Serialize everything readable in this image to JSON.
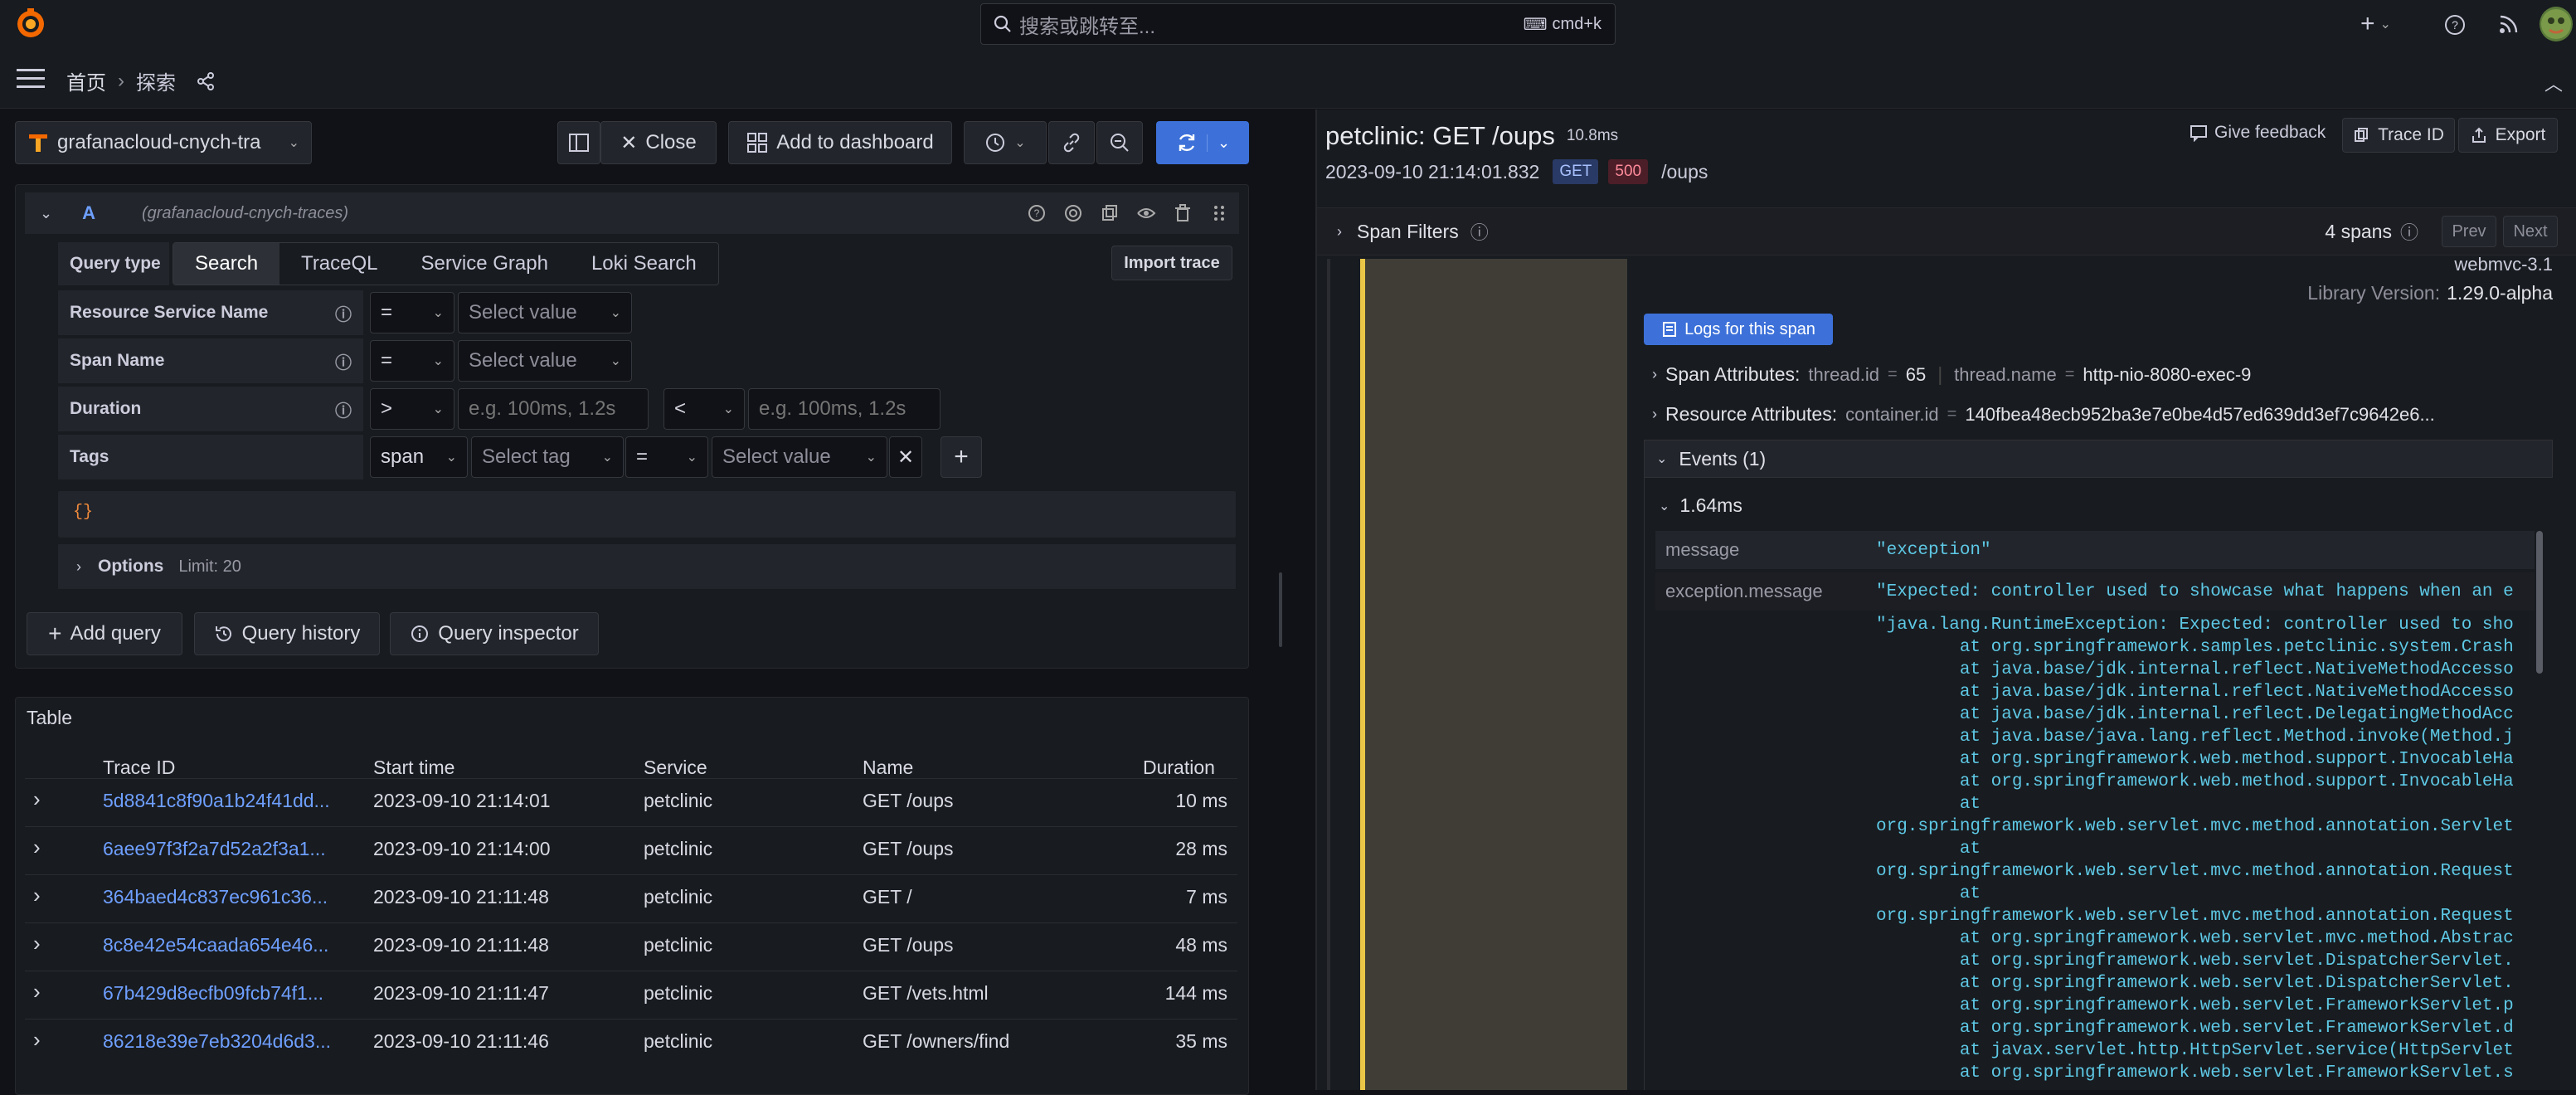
{
  "topbar": {
    "search_placeholder": "搜索或跳转至...",
    "search_shortcut": "cmd+k",
    "add_label": "+",
    "logo_icon": "grafana-logo",
    "help_icon": "help-circle-icon",
    "news_icon": "rss-icon",
    "avatar_icon": "user-avatar"
  },
  "nav": {
    "breadcrumb_home": "首页",
    "breadcrumb_sep": "›",
    "breadcrumb_current": "探索"
  },
  "explore_toolbar": {
    "datasource": "grafanacloud-cnych-tra",
    "close_label": "Close",
    "add_dashboard_label": "Add to dashboard"
  },
  "query": {
    "ref_id": "A",
    "datasource_hint": "(grafanacloud-cnych-traces)",
    "query_type_label": "Query type",
    "tabs": [
      "Search",
      "TraceQL",
      "Service Graph",
      "Loki Search"
    ],
    "import_trace": "Import trace",
    "rows": {
      "service_name": "Resource Service Name",
      "span_name": "Span Name",
      "duration": "Duration",
      "tags": "Tags"
    },
    "op_eq": "=",
    "op_gt": ">",
    "op_lt": "<",
    "select_value": "Select value",
    "select_tag": "Select tag",
    "duration_placeholder": "e.g. 100ms, 1.2s",
    "tag_scope": "span",
    "traceql_preview": "{}",
    "options_label": "Options",
    "options_limit": "Limit: 20",
    "add_query": "Add query",
    "query_history": "Query history",
    "query_inspector": "Query inspector"
  },
  "table": {
    "title": "Table",
    "columns": [
      "Trace ID",
      "Start time",
      "Service",
      "Name",
      "Duration"
    ],
    "rows": [
      {
        "trace_id": "5d8841c8f90a1b24f41dd...",
        "start": "2023-09-10 21:14:01",
        "service": "petclinic",
        "name": "GET /oups",
        "duration": "10 ms"
      },
      {
        "trace_id": "6aee97f3f2a7d52a2f3a1...",
        "start": "2023-09-10 21:14:00",
        "service": "petclinic",
        "name": "GET /oups",
        "duration": "28 ms"
      },
      {
        "trace_id": "364baed4c837ec961c36...",
        "start": "2023-09-10 21:11:48",
        "service": "petclinic",
        "name": "GET /",
        "duration": "7 ms"
      },
      {
        "trace_id": "8c8e42e54caada654e46...",
        "start": "2023-09-10 21:11:48",
        "service": "petclinic",
        "name": "GET /oups",
        "duration": "48 ms"
      },
      {
        "trace_id": "67b429d8ecfb09fcb74f1...",
        "start": "2023-09-10 21:11:47",
        "service": "petclinic",
        "name": "GET /vets.html",
        "duration": "144 ms"
      },
      {
        "trace_id": "86218e39e7eb3204d6d3...",
        "start": "2023-09-10 21:11:46",
        "service": "petclinic",
        "name": "GET /owners/find",
        "duration": "35 ms"
      }
    ]
  },
  "trace": {
    "title": "petclinic: GET /oups",
    "duration": "10.8ms",
    "timestamp": "2023-09-10 21:14:01.832",
    "method": "GET",
    "status": "500",
    "path": "/oups",
    "give_feedback": "Give feedback",
    "trace_id_btn": "Trace ID",
    "export_btn": "Export",
    "span_filters": "Span Filters",
    "spans_count": "4 spans",
    "prev": "Prev",
    "next": "Next",
    "library_name": "webmvc-3.1",
    "library_version_label": "Library Version:",
    "library_version": "1.29.0-alpha",
    "logs_button": "Logs for this span",
    "span_attributes_label": "Span Attributes:",
    "span_attr_1_key": "thread.id",
    "span_attr_1_val": "65",
    "span_attr_2_key": "thread.name",
    "span_attr_2_val": "http-nio-8080-exec-9",
    "resource_attributes_label": "Resource Attributes:",
    "resource_attr_key": "container.id",
    "resource_attr_val": "140fbea48ecb952ba3e7e0be4d57ed639dd3ef7c9642e6...",
    "events_label": "Events (1)",
    "event_time": "1.64ms",
    "event_message_key": "message",
    "event_message_val": "\"exception\"",
    "exception_message_key": "exception.message",
    "exception_message_val": "\"Expected: controller used to showcase what happens when an e",
    "stacktrace": [
      "\"java.lang.RuntimeException: Expected: controller used to sho",
      "        at org.springframework.samples.petclinic.system.Crash",
      "        at java.base/jdk.internal.reflect.NativeMethodAccesso",
      "        at java.base/jdk.internal.reflect.NativeMethodAccesso",
      "        at java.base/jdk.internal.reflect.DelegatingMethodAcc",
      "        at java.base/java.lang.reflect.Method.invoke(Method.j",
      "        at org.springframework.web.method.support.InvocableHa",
      "        at org.springframework.web.method.support.InvocableHa",
      "        at",
      "org.springframework.web.servlet.mvc.method.annotation.Servlet",
      "        at",
      "org.springframework.web.servlet.mvc.method.annotation.Request",
      "        at",
      "org.springframework.web.servlet.mvc.method.annotation.Request",
      "        at org.springframework.web.servlet.mvc.method.Abstrac",
      "        at org.springframework.web.servlet.DispatcherServlet.",
      "        at org.springframework.web.servlet.DispatcherServlet.",
      "        at org.springframework.web.servlet.FrameworkServlet.p",
      "        at org.springframework.web.servlet.FrameworkServlet.d",
      "        at javax.servlet.http.HttpServlet.service(HttpServlet",
      "        at org.springframework.web.servlet.FrameworkServlet.s"
    ]
  }
}
